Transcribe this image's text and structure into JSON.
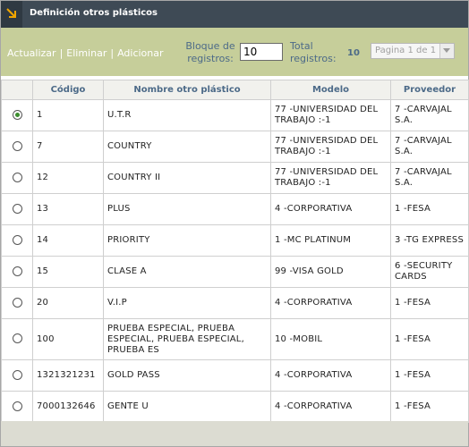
{
  "window": {
    "title": "Definición otros plásticos"
  },
  "toolbar": {
    "refresh_label": "Actualizar",
    "delete_label": "Eliminar",
    "add_label": "Adicionar",
    "separator": "|",
    "block_label_line1": "Bloque de",
    "block_label_line2": "registros:",
    "block_value": "10",
    "total_label_line1": "Total",
    "total_label_line2": "registros:",
    "total_value": "10",
    "pager_value": "Pagina 1 de 1"
  },
  "table": {
    "columns": [
      "",
      "Código",
      "Nombre otro plástico",
      "Modelo",
      "Proveedor"
    ],
    "selected_index": 0,
    "rows": [
      {
        "codigo": "1",
        "nombre": "U.T.R",
        "modelo": "77 -UNIVERSIDAD DEL TRABAJO :-1",
        "proveedor": "7 -CARVAJAL S.A."
      },
      {
        "codigo": "7",
        "nombre": "COUNTRY",
        "modelo": "77 -UNIVERSIDAD DEL TRABAJO :-1",
        "proveedor": "7 -CARVAJAL S.A."
      },
      {
        "codigo": "12",
        "nombre": "COUNTRY II",
        "modelo": "77 -UNIVERSIDAD DEL TRABAJO :-1",
        "proveedor": "7 -CARVAJAL S.A."
      },
      {
        "codigo": "13",
        "nombre": "PLUS",
        "modelo": "4 -CORPORATIVA",
        "proveedor": "1 -FESA"
      },
      {
        "codigo": "14",
        "nombre": "PRIORITY",
        "modelo": "1 -MC PLATINUM",
        "proveedor": "3 -TG EXPRESS"
      },
      {
        "codigo": "15",
        "nombre": "CLASE A",
        "modelo": "99 -VISA GOLD",
        "proveedor": "6 -SECURITY CARDS"
      },
      {
        "codigo": "20",
        "nombre": "V.I.P",
        "modelo": "4 -CORPORATIVA",
        "proveedor": "1 -FESA"
      },
      {
        "codigo": "100",
        "nombre": "PRUEBA ESPECIAL, PRUEBA ESPECIAL, PRUEBA ESPECIAL, PRUEBA ES",
        "modelo": "10 -MOBIL",
        "proveedor": "1 -FESA"
      },
      {
        "codigo": "1321321231",
        "nombre": "GOLD PASS",
        "modelo": "4 -CORPORATIVA",
        "proveedor": "1 -FESA"
      },
      {
        "codigo": "7000132646",
        "nombre": "GENTE U",
        "modelo": "4 -CORPORATIVA",
        "proveedor": "1 -FESA"
      }
    ]
  },
  "colors": {
    "titlebar": "#3e4a55",
    "toolbar": "#c6ce9a",
    "label_blue": "#4c6a88",
    "icon_accent": "#f0a500"
  },
  "icons": {
    "title_icon": "arrow-down-right-icon",
    "pager_arrow": "chevron-down-icon"
  }
}
